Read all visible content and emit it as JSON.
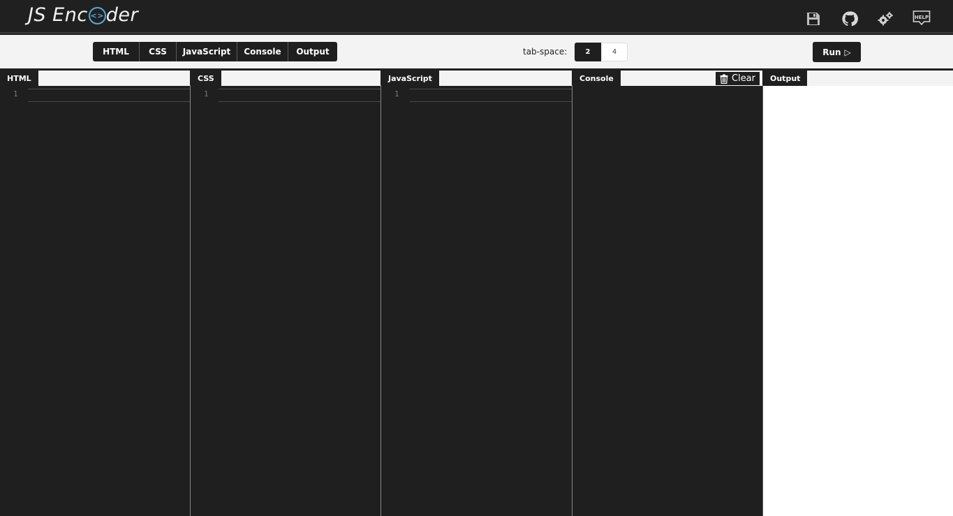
{
  "app": {
    "logo_left": "JS Enc",
    "logo_glyph": "<>",
    "logo_right": "der"
  },
  "header_icons": [
    "save-icon",
    "github-icon",
    "settings-gears-icon",
    "help-icon"
  ],
  "help_icon_text": "HELP",
  "toolbar": {
    "tabs": [
      "HTML",
      "CSS",
      "JavaScript",
      "Console",
      "Output"
    ],
    "tab_space_label": "tab-space:",
    "tab_space_options": [
      "2",
      "4"
    ],
    "tab_space_selected": "2",
    "run_label": "Run",
    "run_icon": "▷"
  },
  "panes": {
    "html": {
      "label": "HTML",
      "line_number": "1"
    },
    "css": {
      "label": "CSS",
      "line_number": "1"
    },
    "js": {
      "label": "JavaScript",
      "line_number": "1"
    },
    "console": {
      "label": "Console",
      "clear_label": "Clear"
    },
    "output": {
      "label": "Output"
    }
  },
  "colors": {
    "dark": "#1f1f1f",
    "light": "#f3f3f3",
    "accent": "#5aa7d6"
  }
}
